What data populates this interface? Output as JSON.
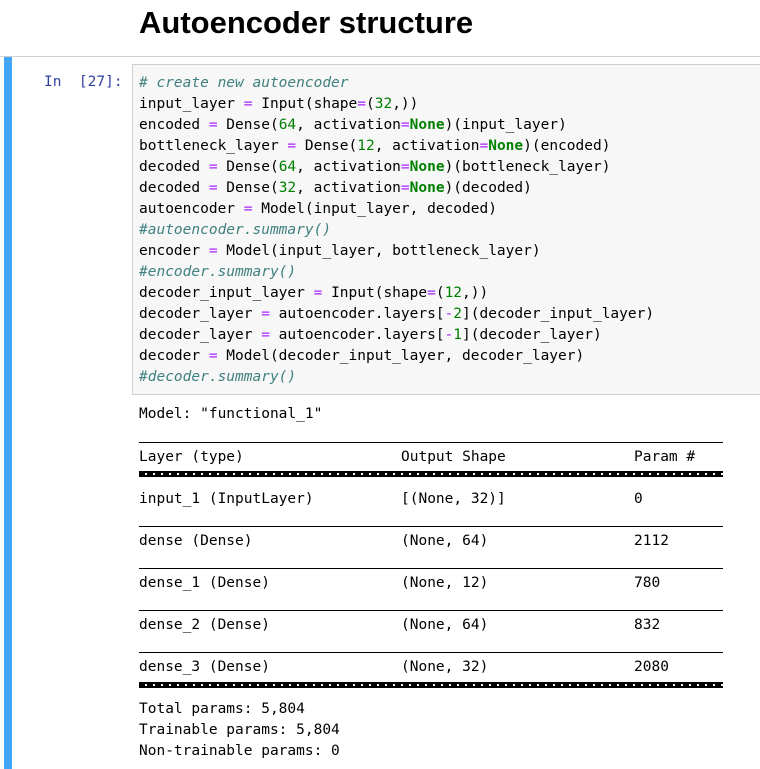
{
  "heading": "Autoencoder structure",
  "cell": {
    "prompt": "In  [27]:",
    "code_lines": [
      [
        {
          "t": "# create new autoencoder",
          "c": "cm"
        }
      ],
      [
        {
          "t": "input_layer "
        },
        {
          "t": "=",
          "c": "op"
        },
        {
          "t": " Input(shape"
        },
        {
          "t": "=",
          "c": "op"
        },
        {
          "t": "("
        },
        {
          "t": "32",
          "c": "num"
        },
        {
          "t": ",))"
        }
      ],
      [
        {
          "t": "encoded "
        },
        {
          "t": "=",
          "c": "op"
        },
        {
          "t": " Dense("
        },
        {
          "t": "64",
          "c": "num"
        },
        {
          "t": ", activation"
        },
        {
          "t": "=",
          "c": "op"
        },
        {
          "t": "None",
          "c": "kw"
        },
        {
          "t": ")(input_layer)"
        }
      ],
      [
        {
          "t": "bottleneck_layer "
        },
        {
          "t": "=",
          "c": "op"
        },
        {
          "t": " Dense("
        },
        {
          "t": "12",
          "c": "num"
        },
        {
          "t": ", activation"
        },
        {
          "t": "=",
          "c": "op"
        },
        {
          "t": "None",
          "c": "kw"
        },
        {
          "t": ")(encoded)"
        }
      ],
      [
        {
          "t": "decoded "
        },
        {
          "t": "=",
          "c": "op"
        },
        {
          "t": " Dense("
        },
        {
          "t": "64",
          "c": "num"
        },
        {
          "t": ", activation"
        },
        {
          "t": "=",
          "c": "op"
        },
        {
          "t": "None",
          "c": "kw"
        },
        {
          "t": ")(bottleneck_layer)"
        }
      ],
      [
        {
          "t": "decoded "
        },
        {
          "t": "=",
          "c": "op"
        },
        {
          "t": " Dense("
        },
        {
          "t": "32",
          "c": "num"
        },
        {
          "t": ", activation"
        },
        {
          "t": "=",
          "c": "op"
        },
        {
          "t": "None",
          "c": "kw"
        },
        {
          "t": ")(decoded)"
        }
      ],
      [
        {
          "t": "autoencoder "
        },
        {
          "t": "=",
          "c": "op"
        },
        {
          "t": " Model(input_layer, decoded)"
        }
      ],
      [
        {
          "t": "#autoencoder.summary()",
          "c": "cm"
        }
      ],
      [
        {
          "t": "encoder "
        },
        {
          "t": "=",
          "c": "op"
        },
        {
          "t": " Model(input_layer, bottleneck_layer)"
        }
      ],
      [
        {
          "t": "#encoder.summary()",
          "c": "cm"
        }
      ],
      [
        {
          "t": "decoder_input_layer "
        },
        {
          "t": "=",
          "c": "op"
        },
        {
          "t": " Input(shape"
        },
        {
          "t": "=",
          "c": "op"
        },
        {
          "t": "("
        },
        {
          "t": "12",
          "c": "num"
        },
        {
          "t": ",))"
        }
      ],
      [
        {
          "t": "decoder_layer "
        },
        {
          "t": "=",
          "c": "op"
        },
        {
          "t": " autoencoder.layers["
        },
        {
          "t": "-",
          "c": "op"
        },
        {
          "t": "2",
          "c": "num"
        },
        {
          "t": "](decoder_input_layer)"
        }
      ],
      [
        {
          "t": "decoder_layer "
        },
        {
          "t": "=",
          "c": "op"
        },
        {
          "t": " autoencoder.layers["
        },
        {
          "t": "-",
          "c": "op"
        },
        {
          "t": "1",
          "c": "num"
        },
        {
          "t": "](decoder_layer)"
        }
      ],
      [
        {
          "t": "decoder "
        },
        {
          "t": "=",
          "c": "op"
        },
        {
          "t": " Model(decoder_input_layer, decoder_layer)"
        }
      ],
      [
        {
          "t": "#decoder.summary()",
          "c": "cm"
        }
      ]
    ]
  },
  "output": {
    "model_line": "Model: \"functional_1\"",
    "headers": [
      "Layer (type)",
      "Output Shape",
      "Param #"
    ],
    "rows": [
      [
        "input_1 (InputLayer)",
        "[(None, 32)]",
        "0"
      ],
      [
        "dense (Dense)",
        "(None, 64)",
        "2112"
      ],
      [
        "dense_1 (Dense)",
        "(None, 12)",
        "780"
      ],
      [
        "dense_2 (Dense)",
        "(None, 64)",
        "832"
      ],
      [
        "dense_3 (Dense)",
        "(None, 32)",
        "2080"
      ]
    ],
    "total_params": "Total params: 5,804",
    "trainable_params": "Trainable params: 5,804",
    "non_trainable_params": "Non-trainable params: 0"
  }
}
